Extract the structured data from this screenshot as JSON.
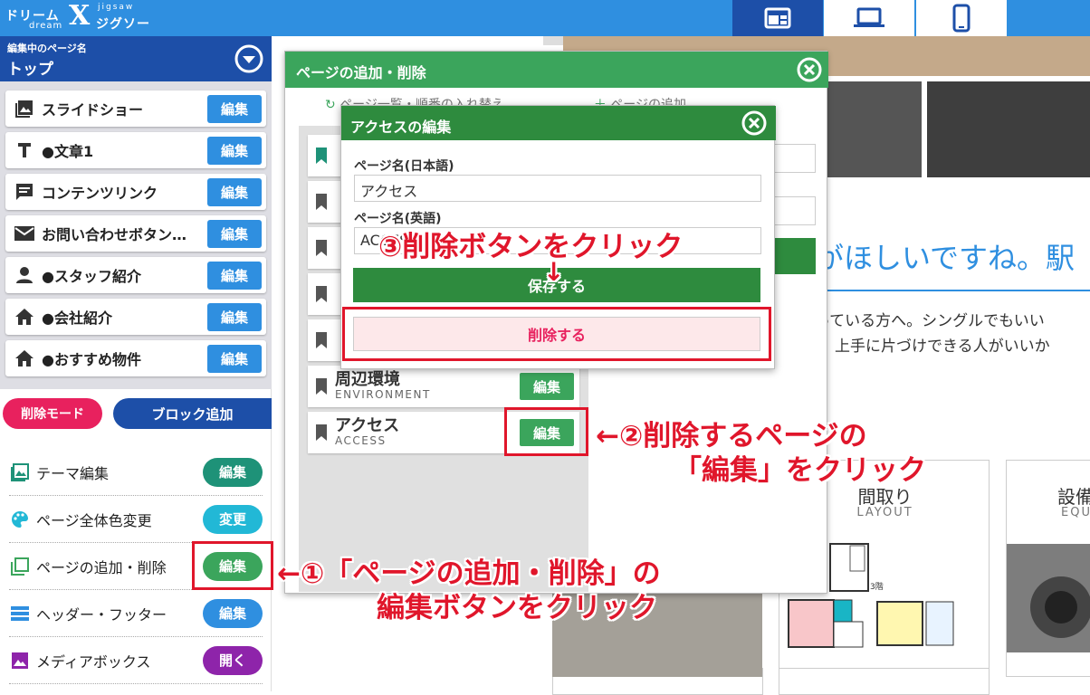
{
  "app": {
    "logo_line1": "ドリーム",
    "logo_x": "X",
    "logo_line2": "dream",
    "logo_line3": "jigsaw",
    "logo_line4": "ジグソー"
  },
  "device_icons": [
    "layout-icon",
    "laptop-icon",
    "smartphone-icon"
  ],
  "sidebar": {
    "editing_label": "編集中のページ名",
    "editing_page": "トップ",
    "blocks": [
      {
        "label": "スライドショー",
        "icon": "image-icon",
        "button": "編集"
      },
      {
        "label": "●文章1",
        "icon": "text-icon",
        "button": "編集"
      },
      {
        "label": "コンテンツリンク",
        "icon": "comment-icon",
        "button": "編集"
      },
      {
        "label": "お問い合わせボタン…",
        "icon": "mail-icon",
        "button": "編集"
      },
      {
        "label": "●スタッフ紹介",
        "icon": "person-icon",
        "button": "編集"
      },
      {
        "label": "●会社紹介",
        "icon": "home-icon",
        "button": "編集"
      },
      {
        "label": "●おすすめ物件",
        "icon": "home-icon",
        "button": "編集"
      }
    ],
    "delete_mode": "削除モード",
    "block_add": "ブロック追加",
    "menu": [
      {
        "label": "テーマ編集",
        "icon": "image-icon",
        "button": "編集",
        "color": "#1e9278"
      },
      {
        "label": "ページ全体色変更",
        "icon": "palette-icon",
        "button": "変更",
        "color": "#22b8d6"
      },
      {
        "label": "ページの追加・削除",
        "icon": "pages-icon",
        "button": "編集",
        "color": "#3ba55c"
      },
      {
        "label": "ヘッダー・フッター",
        "icon": "header-icon",
        "button": "編集",
        "color": "#2f8fe0"
      },
      {
        "label": "メディアボックス",
        "icon": "media-icon",
        "button": "開く",
        "color": "#8e24aa"
      }
    ]
  },
  "background_site": {
    "heading": "がほしいですね。駅",
    "line1": "っている方へ。シングルでもいい",
    "line2": "上手に片づけできる人がいいか",
    "card1_title": "間取り",
    "card1_sub": "LAYOUT",
    "card2_title": "設備",
    "card2_sub": "EQU",
    "floor_label": "3階"
  },
  "modal_pages": {
    "title": "ページの追加・削除",
    "toolbar_reorder": "ページ一覧・順番の入れ替え",
    "toolbar_add": "ページの追加",
    "pages": [
      {
        "ja": "",
        "en": ""
      },
      {
        "ja": "",
        "en": ""
      },
      {
        "ja": "",
        "en": ""
      },
      {
        "ja": "",
        "en": ""
      },
      {
        "ja": "",
        "en": ""
      },
      {
        "ja": "周辺環境",
        "en": "ENVIRONMENT",
        "button": "編集"
      },
      {
        "ja": "アクセス",
        "en": "ACCESS",
        "button": "編集"
      }
    ]
  },
  "modal_access": {
    "title": "アクセスの編集",
    "label_ja": "ページ名(日本語)",
    "value_ja": "アクセス",
    "label_en": "ページ名(英語)",
    "value_en": "ACCESS",
    "save": "保存する",
    "delete": "削除する"
  },
  "annotations": {
    "step1_line1": "←①「ページの追加・削除」の",
    "step1_line2": "編集ボタンをクリック",
    "step2_line1": "←②削除するページの",
    "step2_line2": "「編集」をクリック",
    "step3": "③削除ボタンをクリック",
    "arrow_down": "↓"
  },
  "colors": {
    "topbar": "#2f8fe0",
    "navy": "#1d4fa8",
    "green": "#3ba55c",
    "dark_green": "#2e8b3e",
    "annotation_red": "#e0162b",
    "delete_pink": "#e8215e"
  }
}
